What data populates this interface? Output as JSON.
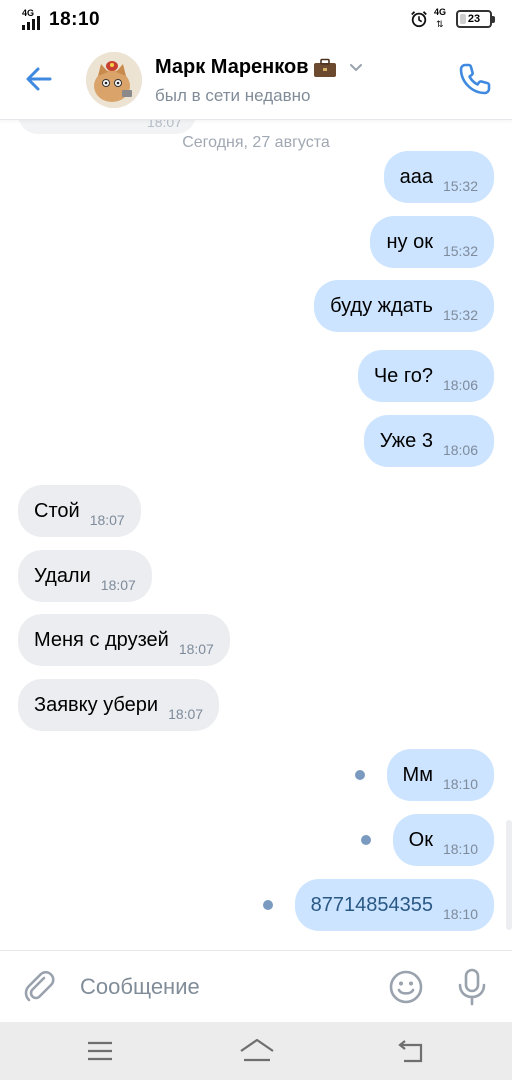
{
  "status_bar": {
    "network_left": "4G",
    "time": "18:10",
    "network_right": "4G",
    "battery": "23",
    "battery_level_percent": 23,
    "icons": [
      "signal-icon",
      "alarm-icon",
      "network-4g-icon",
      "battery-icon"
    ]
  },
  "header": {
    "name": "Марк Маренков",
    "status": "был в сети недавно",
    "icons": [
      "back-arrow-icon",
      "avatar",
      "briefcase-emoji-icon",
      "chevron-down-icon",
      "phone-icon"
    ]
  },
  "chat": {
    "partial_time": "18:07",
    "date_separator": "Сегодня, 27 августа",
    "messages": [
      {
        "dir": "out",
        "text": "ааа",
        "time": "15:32",
        "unread": false
      },
      {
        "dir": "out",
        "text": "ну ок",
        "time": "15:32",
        "unread": false
      },
      {
        "dir": "out",
        "text": "буду ждать",
        "time": "15:32",
        "unread": false
      },
      {
        "dir": "out",
        "text": "Че го?",
        "time": "18:06",
        "unread": false
      },
      {
        "dir": "out",
        "text": "Уже 3",
        "time": "18:06",
        "unread": false
      },
      {
        "dir": "in",
        "text": "Стой",
        "time": "18:07",
        "unread": false
      },
      {
        "dir": "in",
        "text": "Удали",
        "time": "18:07",
        "unread": false
      },
      {
        "dir": "in",
        "text": "Меня с друзей",
        "time": "18:07",
        "unread": false
      },
      {
        "dir": "in",
        "text": "Заявку убери",
        "time": "18:07",
        "unread": false
      },
      {
        "dir": "out",
        "text": "Мм",
        "time": "18:10",
        "unread": true
      },
      {
        "dir": "out",
        "text": "Ок",
        "time": "18:10",
        "unread": true
      },
      {
        "dir": "out",
        "text": "87714854355",
        "time": "18:10",
        "unread": true,
        "link": true
      }
    ]
  },
  "composer": {
    "placeholder": "Сообщение",
    "value": "",
    "icons": [
      "paperclip-icon",
      "emoji-icon",
      "microphone-icon"
    ]
  },
  "navbar": {
    "icons": [
      "menu-icon",
      "home-icon",
      "back-icon"
    ]
  },
  "colors": {
    "accent": "#3f8ae0",
    "outgoing_bubble": "#cce4ff",
    "incoming_bubble": "#ebedf0",
    "secondary_text": "#818c99",
    "unread_dot": "#7b9ac0",
    "link_text": "#2a5885"
  }
}
